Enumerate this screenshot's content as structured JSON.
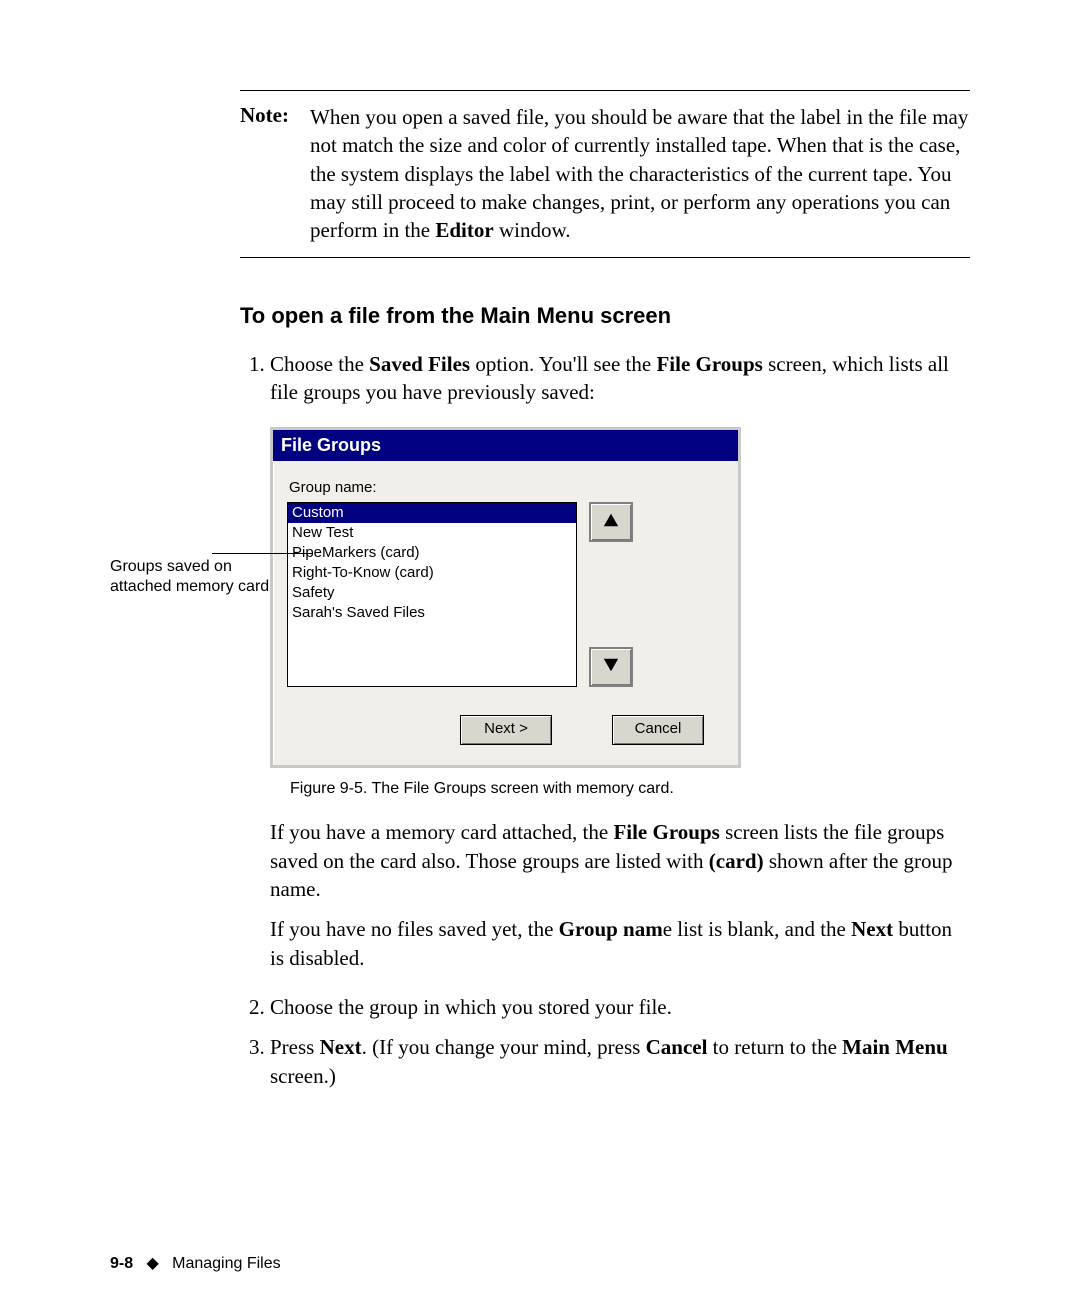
{
  "note": {
    "label": "Note:",
    "text_before": "When you open a saved file, you should be aware that the label in the file may not match the size and color of currently installed tape. When that is the case, the system displays the label with the characteristics of the current tape. You may still proceed to make changes, print, or perform any operations you can perform in the ",
    "editor_word": "Editor",
    "text_after": " window."
  },
  "heading": "To open a file from the Main Menu screen",
  "step1": {
    "a": "Choose the ",
    "b": "Saved Files",
    "c": " option. You'll see the ",
    "d": "File Groups",
    "e": " screen, which lists all file groups you have previously saved:"
  },
  "callout": "Groups saved on attached memory card",
  "dialog": {
    "title": "File Groups",
    "label": "Group name:",
    "items": [
      "Custom",
      "New Test",
      "PipeMarkers (card)",
      "Right-To-Know (card)",
      "Safety",
      "Sarah's Saved Files"
    ],
    "next_btn": "Next >",
    "cancel_btn": "Cancel"
  },
  "caption": "Figure 9-5. The File Groups screen with memory card.",
  "para1": {
    "a": "If you have a memory card attached, the ",
    "b": "File Groups",
    "c": " screen lists the file groups saved on the card also. Those groups are listed with ",
    "d": "(card)",
    "e": " shown after the group name."
  },
  "para2": {
    "a": "If you have no files saved yet, the ",
    "b": "Group nam",
    "c": "e list is blank, and the ",
    "d": "Next",
    "e": " button is disabled."
  },
  "step2": "Choose the group in which you stored your file.",
  "step3": {
    "a": "Press ",
    "b": "Next",
    "c": ". (If you change your mind, press ",
    "d": "Cancel",
    "e": " to return to the ",
    "f": "Main Menu",
    "g": " screen.)"
  },
  "footer": {
    "page": "9-8",
    "diamond": "◆",
    "section": "Managing Files"
  }
}
